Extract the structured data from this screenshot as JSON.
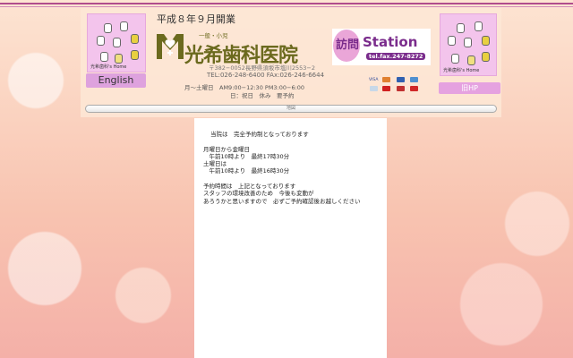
{
  "header": {
    "opening": "平成８年９月開業",
    "clinic_type": "一般・小児",
    "clinic_name": "光希歯科医院",
    "address": "〒382−0052長野県須坂市塩川2553−2",
    "phone": "TEL:026-248-6400 FAx:026-246-6644",
    "hours": "月〜土曜日　AM9:00−12:30 PM3:00−6:00",
    "closed": "日：祝日　休み　要予約",
    "left_caption": "光希歯科's Home",
    "english_label": "English",
    "right_caption": "光希歯科's Home",
    "old_hp_label": "旧HP",
    "station": {
      "kanji": "訪問",
      "word": "Station",
      "tel": "tel.fax.247-8272"
    },
    "cards": [
      "VISA"
    ],
    "map_label": "地図"
  },
  "content": {
    "lines": [
      "当院は　完全予約制となっております",
      "",
      "月曜日から金曜日",
      "　午前10時より　最終17時30分",
      "土曜日は",
      "　午前10時より　最終16時30分",
      "",
      "予約時間は　上記となっております",
      "スタッフの環境改善のため　今後も変動が",
      "あろうかと思いますので　必ずご予約確認後お越しください"
    ]
  },
  "colors": {
    "accent": "#b04c8c",
    "logo_green": "#6b6a1e",
    "button_pink": "#e5a2e0"
  }
}
